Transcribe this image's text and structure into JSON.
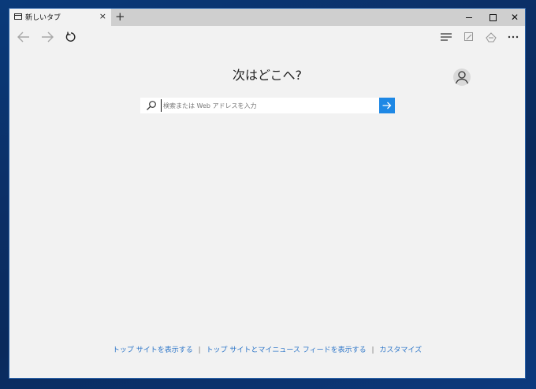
{
  "tab": {
    "title": "新しいタブ"
  },
  "heading": "次はどこへ?",
  "search": {
    "placeholder": "検索または Web アドレスを入力"
  },
  "footer_links": [
    "トップ サイトを表示する",
    "トップ サイトとマイニュース フィードを表示する",
    "カスタマイズ"
  ],
  "footer_separator": "|",
  "icons": {
    "tab": "tab-page-icon",
    "close_tab": "close-icon",
    "new_tab": "plus-icon",
    "back": "back-arrow-icon",
    "forward": "forward-arrow-icon",
    "refresh": "refresh-icon",
    "hub": "hub-icon",
    "notes": "web-note-icon",
    "share": "share-icon",
    "more": "more-icon",
    "profile": "profile-icon",
    "search": "search-icon",
    "go": "arrow-right-icon"
  },
  "colors": {
    "accent": "#1e88e5",
    "link": "#2a74c8",
    "titlebar": "#cfcfcf",
    "page_bg": "#f2f2f2"
  }
}
